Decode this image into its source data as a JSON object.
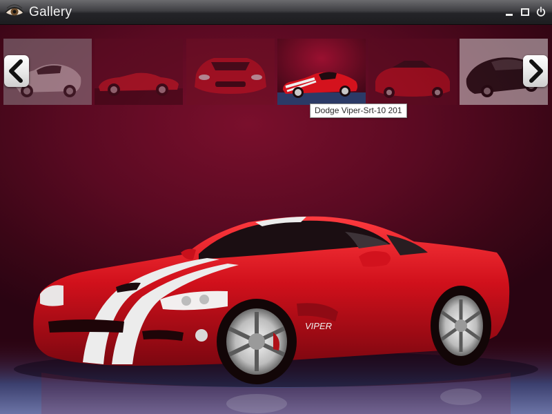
{
  "window": {
    "title": "Gallery"
  },
  "title_bar": {
    "app_icon": "eye-icon",
    "controls": [
      {
        "name": "minimize",
        "icon": "minimize-icon"
      },
      {
        "name": "maximize",
        "icon": "maximize-icon"
      },
      {
        "name": "power",
        "icon": "power-icon"
      }
    ]
  },
  "thumbnails": {
    "prev_icon": "chevron-left-icon",
    "next_icon": "chevron-right-icon",
    "items": [
      {
        "icon": "silver-concept-car-thumbnail",
        "selected": false
      },
      {
        "icon": "red-roadster-side-thumbnail",
        "selected": false
      },
      {
        "icon": "red-viper-front-thumbnail",
        "selected": false
      },
      {
        "icon": "red-viper-srt10-thumbnail",
        "selected": true
      },
      {
        "icon": "red-convertible-thumbnail",
        "selected": false
      },
      {
        "icon": "dark-coupe-thumbnail",
        "selected": false
      }
    ]
  },
  "tooltip": {
    "text": "Dodge Viper-Srt-10 201"
  },
  "main_photo": {
    "icon": "red-dodge-viper-photo",
    "badge_text": "VIPER"
  },
  "colors": {
    "background": "#5a0a22",
    "titlebar": "#2a2a2e",
    "car_red": "#c8101c",
    "stripe": "#e9e9e9"
  }
}
